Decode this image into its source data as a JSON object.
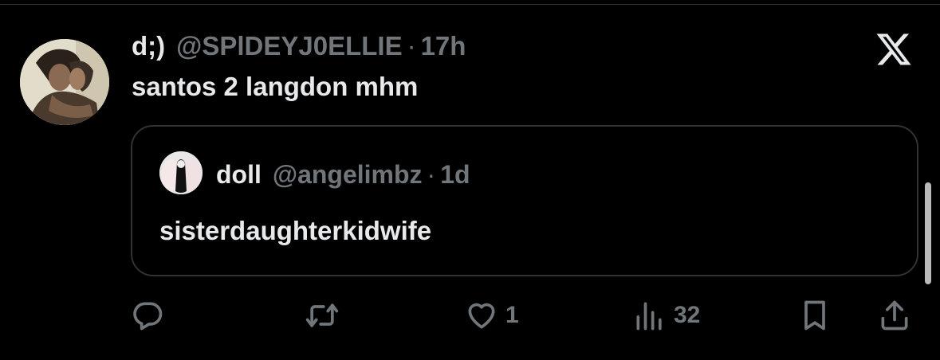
{
  "tweet": {
    "display_name": "d;)",
    "handle": "@SPlDEYJ0ELLIE",
    "separator": "·",
    "time": "17h",
    "text": "santos 2 langdon mhm"
  },
  "quote": {
    "display_name": "doll",
    "handle": "@angelimbz",
    "separator": "·",
    "time": "1d",
    "text": "sisterdaughterkidwife"
  },
  "actions": {
    "reply_icon": "reply-bubble-icon",
    "retweet_icon": "retweet-icon",
    "like_icon": "heart-icon",
    "like_count": "1",
    "views_icon": "views-bar-chart-icon",
    "views_count": "32",
    "bookmark_icon": "bookmark-icon",
    "share_icon": "share-upload-icon"
  },
  "colors": {
    "background": "#000000",
    "text_primary": "#e7e9ea",
    "text_secondary": "#71767b",
    "border": "#2f3336"
  }
}
